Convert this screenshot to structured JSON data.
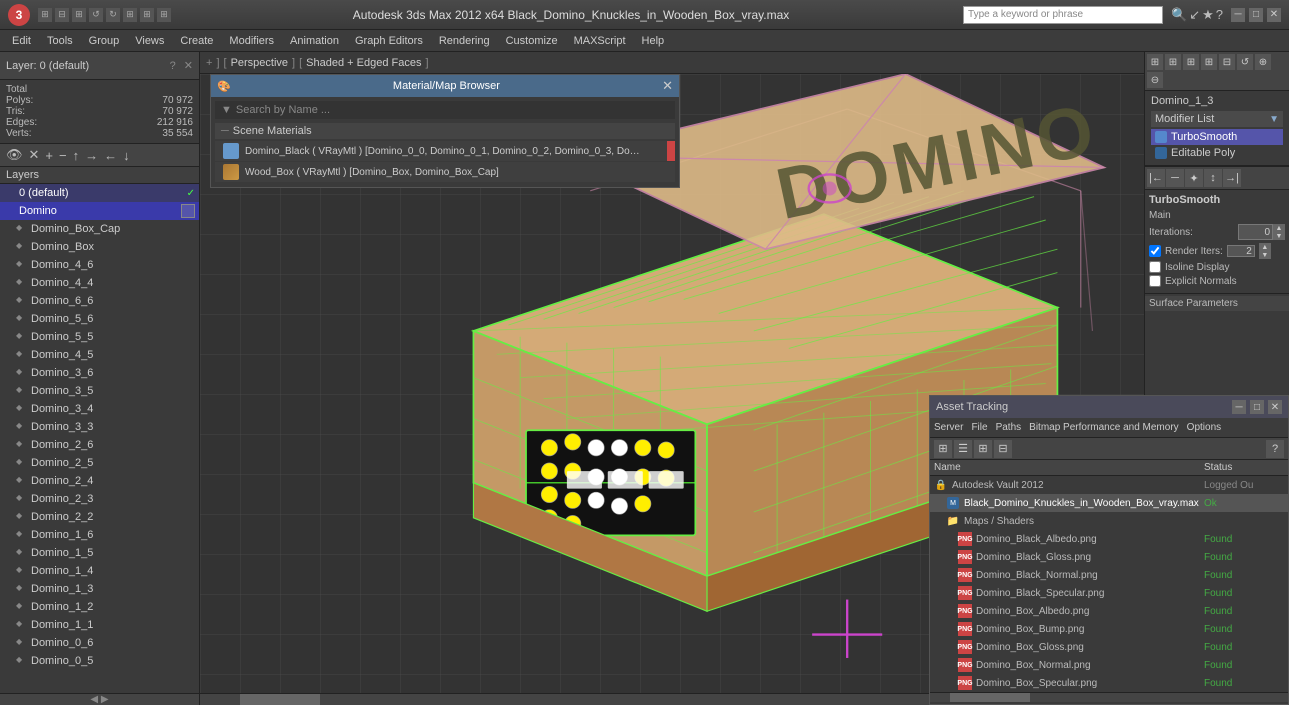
{
  "titlebar": {
    "app_icon": "3",
    "title": "Autodesk 3ds Max 2012 x64         Black_Domino_Knuckles_in_Wooden_Box_vray.max",
    "search_placeholder": "Type a keyword or phrase",
    "minimize": "─",
    "maximize": "□",
    "close": "✕"
  },
  "menubar": {
    "items": [
      "Edit",
      "Tools",
      "Group",
      "Views",
      "Create",
      "Modifiers",
      "Animation",
      "Graph Editors",
      "Rendering",
      "Customize",
      "MAXScript",
      "Help"
    ]
  },
  "left_panel": {
    "layer_header": "Layer: 0 (default)",
    "stats": {
      "total": "Total",
      "polys_label": "Polys:",
      "polys_value": "70 972",
      "tris_label": "Tris:",
      "tris_value": "70 972",
      "edges_label": "Edges:",
      "edges_value": "212 916",
      "verts_label": "Verts:",
      "verts_value": "35 554"
    },
    "layers_title": "Layers",
    "layers": [
      {
        "name": "0 (default)",
        "level": 0,
        "checked": true,
        "selected": true
      },
      {
        "name": "Domino",
        "level": 0,
        "checked": false,
        "selected": true,
        "domino": true
      },
      {
        "name": "Domino_Box_Cap",
        "level": 1
      },
      {
        "name": "Domino_Box",
        "level": 1
      },
      {
        "name": "Domino_4_6",
        "level": 1
      },
      {
        "name": "Domino_4_4",
        "level": 1
      },
      {
        "name": "Domino_6_6",
        "level": 1
      },
      {
        "name": "Domino_5_6",
        "level": 1
      },
      {
        "name": "Domino_5_5",
        "level": 1
      },
      {
        "name": "Domino_4_5",
        "level": 1
      },
      {
        "name": "Domino_3_6",
        "level": 1
      },
      {
        "name": "Domino_3_5",
        "level": 1
      },
      {
        "name": "Domino_3_4",
        "level": 1
      },
      {
        "name": "Domino_3_3",
        "level": 1
      },
      {
        "name": "Domino_2_6",
        "level": 1
      },
      {
        "name": "Domino_2_5",
        "level": 1
      },
      {
        "name": "Domino_2_4",
        "level": 1
      },
      {
        "name": "Domino_2_3",
        "level": 1
      },
      {
        "name": "Domino_2_2",
        "level": 1
      },
      {
        "name": "Domino_1_6",
        "level": 1
      },
      {
        "name": "Domino_1_5",
        "level": 1
      },
      {
        "name": "Domino_1_4",
        "level": 1
      },
      {
        "name": "Domino_1_3",
        "level": 1
      },
      {
        "name": "Domino_1_2",
        "level": 1
      },
      {
        "name": "Domino_1_1",
        "level": 1
      },
      {
        "name": "Domino_0_6",
        "level": 1
      },
      {
        "name": "Domino_0_5",
        "level": 1
      }
    ]
  },
  "viewport": {
    "breadcrumb": "+ ] [ Perspective ] [ Shaded + Edged Faces ]"
  },
  "material_browser": {
    "title": "Material/Map Browser",
    "search_label": "Search by Name ...",
    "section_title": "Scene Materials",
    "materials": [
      {
        "name": "Domino_Black ( VRayMtl ) [Domino_0_0, Domino_0_1, Domino_0_2, Domino_0_3, Domino_0_...",
        "type": "vray",
        "has_bar": true
      },
      {
        "name": "Wood_Box ( VRayMtl ) [Domino_Box, Domino_Box_Cap]",
        "type": "wood",
        "has_bar": false
      }
    ]
  },
  "right_panel": {
    "obj_name": "Domino_1_3",
    "modifier_list_label": "Modifier List",
    "modifiers": [
      {
        "name": "TurboSmooth",
        "selected": true
      },
      {
        "name": "Editable Poly",
        "selected": false
      }
    ],
    "turbosmooth": {
      "title": "TurboSmooth",
      "main_label": "Main",
      "iterations_label": "Iterations:",
      "iterations_value": "0",
      "render_iters_label": "Render Iters:",
      "render_iters_value": "2",
      "isoline_label": "Isoline Display",
      "explicit_label": "Explicit Normals",
      "surface_params": "Surface Parameters"
    }
  },
  "asset_tracking": {
    "title": "Asset Tracking",
    "menu_items": [
      "Server",
      "File",
      "Paths",
      "Bitmap Performance and Memory",
      "Options"
    ],
    "col_name": "Name",
    "col_status": "Status",
    "toolbar_icons": [
      "table1",
      "table2",
      "table3",
      "table4"
    ],
    "rows": [
      {
        "name": "Autodesk Vault 2012",
        "status": "Logged Ou",
        "level": 0,
        "icon": "vault"
      },
      {
        "name": "Black_Domino_Knuckles_in_Wooden_Box_vray.max",
        "status": "Ok",
        "level": 1,
        "icon": "max"
      },
      {
        "name": "Maps / Shaders",
        "status": "",
        "level": 1,
        "icon": "folder"
      },
      {
        "name": "Domino_Black_Albedo.png",
        "status": "Found",
        "level": 2,
        "icon": "png"
      },
      {
        "name": "Domino_Black_Gloss.png",
        "status": "Found",
        "level": 2,
        "icon": "png"
      },
      {
        "name": "Domino_Black_Normal.png",
        "status": "Found",
        "level": 2,
        "icon": "png"
      },
      {
        "name": "Domino_Black_Specular.png",
        "status": "Found",
        "level": 2,
        "icon": "png"
      },
      {
        "name": "Domino_Box_Albedo.png",
        "status": "Found",
        "level": 2,
        "icon": "png"
      },
      {
        "name": "Domino_Box_Bump.png",
        "status": "Found",
        "level": 2,
        "icon": "png"
      },
      {
        "name": "Domino_Box_Gloss.png",
        "status": "Found",
        "level": 2,
        "icon": "png"
      },
      {
        "name": "Domino_Box_Normal.png",
        "status": "Found",
        "level": 2,
        "icon": "png"
      },
      {
        "name": "Domino_Box_Specular.png",
        "status": "Found",
        "level": 2,
        "icon": "png"
      }
    ]
  },
  "colors": {
    "accent": "#5566aa",
    "selected_bg": "#3a3aaa",
    "found": "#44aa44",
    "ok": "#44aa44"
  }
}
